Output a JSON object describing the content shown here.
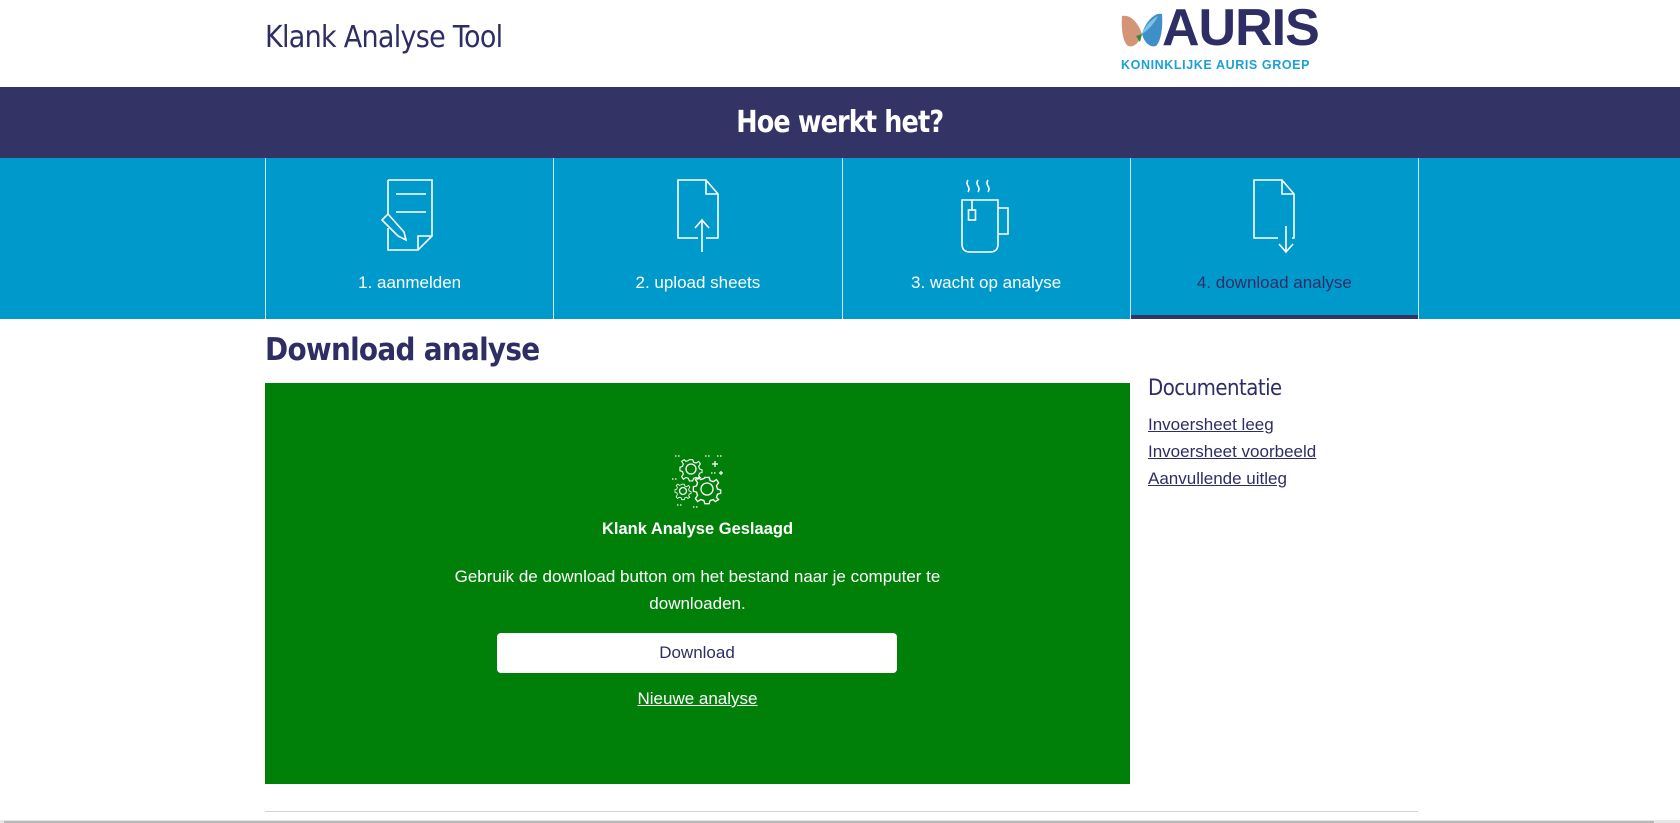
{
  "header": {
    "app_title": "Klank Analyse Tool",
    "logo": {
      "wordmark": "AURIS",
      "subtitle": "KONINKLIJKE AURIS GROEP",
      "colors": {
        "primary": "#2f2e64",
        "secondary": "#1ba1d6"
      }
    }
  },
  "howto": {
    "title": "Hoe werkt het?",
    "steps": [
      {
        "label": "1. aanmelden",
        "icon": "document-pen-icon",
        "active": false
      },
      {
        "label": "2. upload sheets",
        "icon": "file-upload-icon",
        "active": false
      },
      {
        "label": "3. wacht op analyse",
        "icon": "mug-icon",
        "active": false
      },
      {
        "label": "4. download analyse",
        "icon": "file-download-icon",
        "active": true
      }
    ]
  },
  "main": {
    "heading": "Download analyse",
    "result": {
      "icon": "gears-icon",
      "title": "Klank Analyse Geslaagd",
      "text": "Gebruik de download button om het bestand naar je computer te downloaden.",
      "download_label": "Download",
      "new_analysis_label": "Nieuwe analyse",
      "status_color": "#008009"
    }
  },
  "sidebar": {
    "title": "Documentatie",
    "links": [
      {
        "label": "Invoersheet leeg"
      },
      {
        "label": "Invoersheet voorbeeld"
      },
      {
        "label": "Aanvullende uitleg"
      }
    ]
  },
  "theme": {
    "navy": "#343366",
    "blue": "#0099cc",
    "green": "#008009"
  }
}
